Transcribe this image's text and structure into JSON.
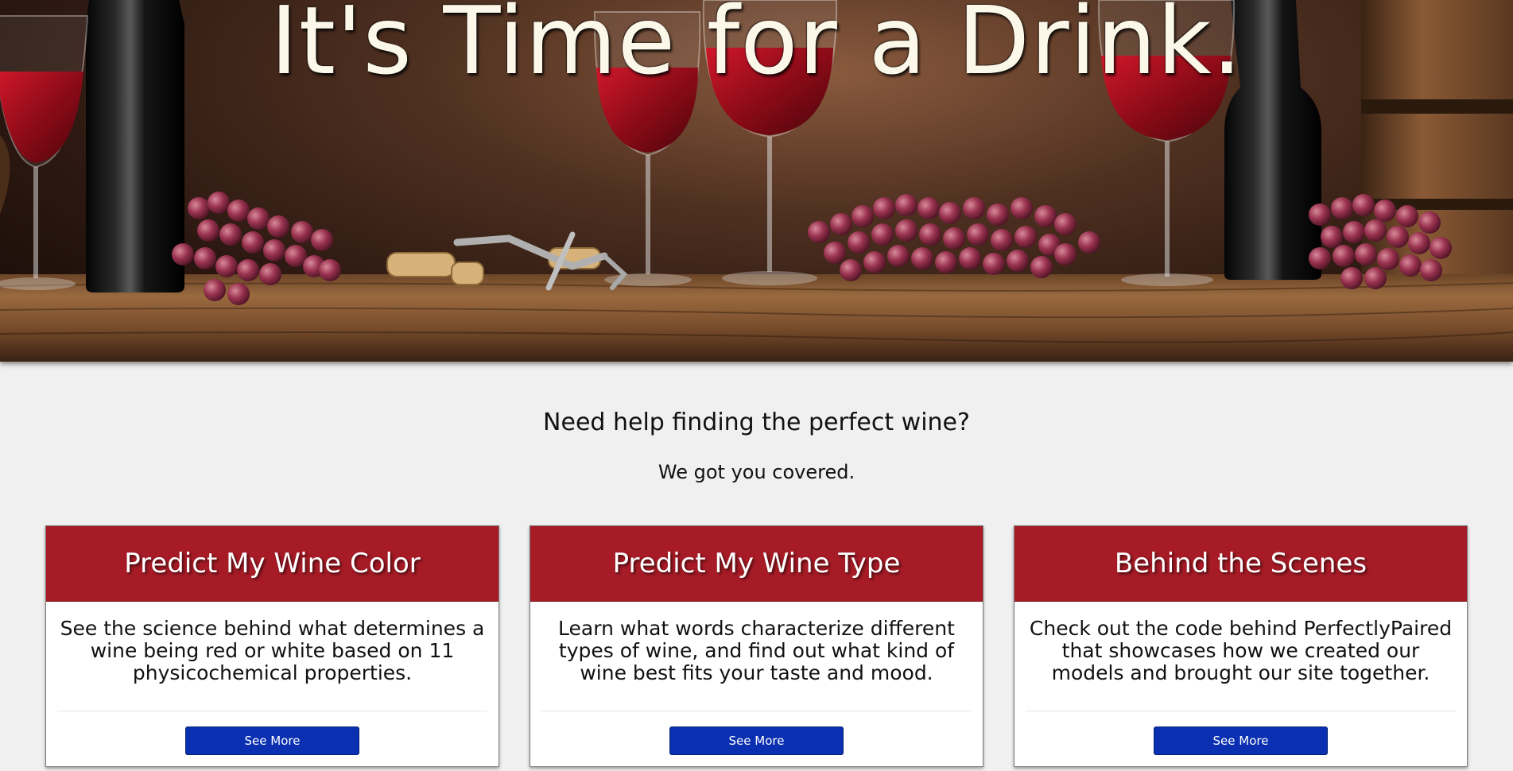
{
  "hero": {
    "title": "It's Time for a Drink.",
    "image": "wine-glasses-bottles-grapes-on-wooden-shelf"
  },
  "intro": {
    "heading": "Need help finding the perfect wine?",
    "subheading": "We got you covered."
  },
  "colors": {
    "card_header": "#a61b26",
    "button": "#0a2fb0",
    "page_background": "#f0f0f0"
  },
  "cards": [
    {
      "title": "Predict My Wine Color",
      "text": "See the science behind what determines a wine being red or white based on 11 physicochemical properties.",
      "button": "See More"
    },
    {
      "title": "Predict My Wine Type",
      "text": "Learn what words characterize different types of wine, and find out what kind of wine best fits your taste and mood.",
      "button": "See More"
    },
    {
      "title": "Behind the Scenes",
      "text": "Check out the code behind PerfectlyPaired that showcases how we created our models and brought our site together.",
      "button": "See More"
    }
  ]
}
